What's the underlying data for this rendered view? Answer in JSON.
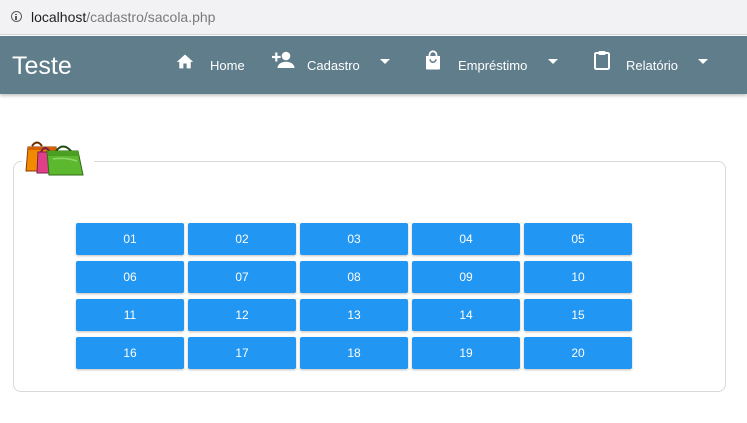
{
  "browser": {
    "url_host": "localhost",
    "url_path": "/cadastro/sacola.php"
  },
  "navbar": {
    "brand": "Teste",
    "items": [
      {
        "label": "Home",
        "icon": "home-icon"
      },
      {
        "label": "Cadastro",
        "icon": "person-add-icon",
        "dropdown": true
      },
      {
        "label": "Empréstimo",
        "icon": "shopping-bag-icon",
        "dropdown": true
      },
      {
        "label": "Relatório",
        "icon": "clipboard-icon",
        "dropdown": true
      }
    ],
    "bg_color": "#607d8b"
  },
  "panel": {
    "legend_icon": "shopping-bags-icon"
  },
  "bags": [
    "01",
    "02",
    "03",
    "04",
    "05",
    "06",
    "07",
    "08",
    "09",
    "10",
    "11",
    "12",
    "13",
    "14",
    "15",
    "16",
    "17",
    "18",
    "19",
    "20"
  ],
  "colors": {
    "button": "#2196f3",
    "button_text": "#ffffff"
  }
}
